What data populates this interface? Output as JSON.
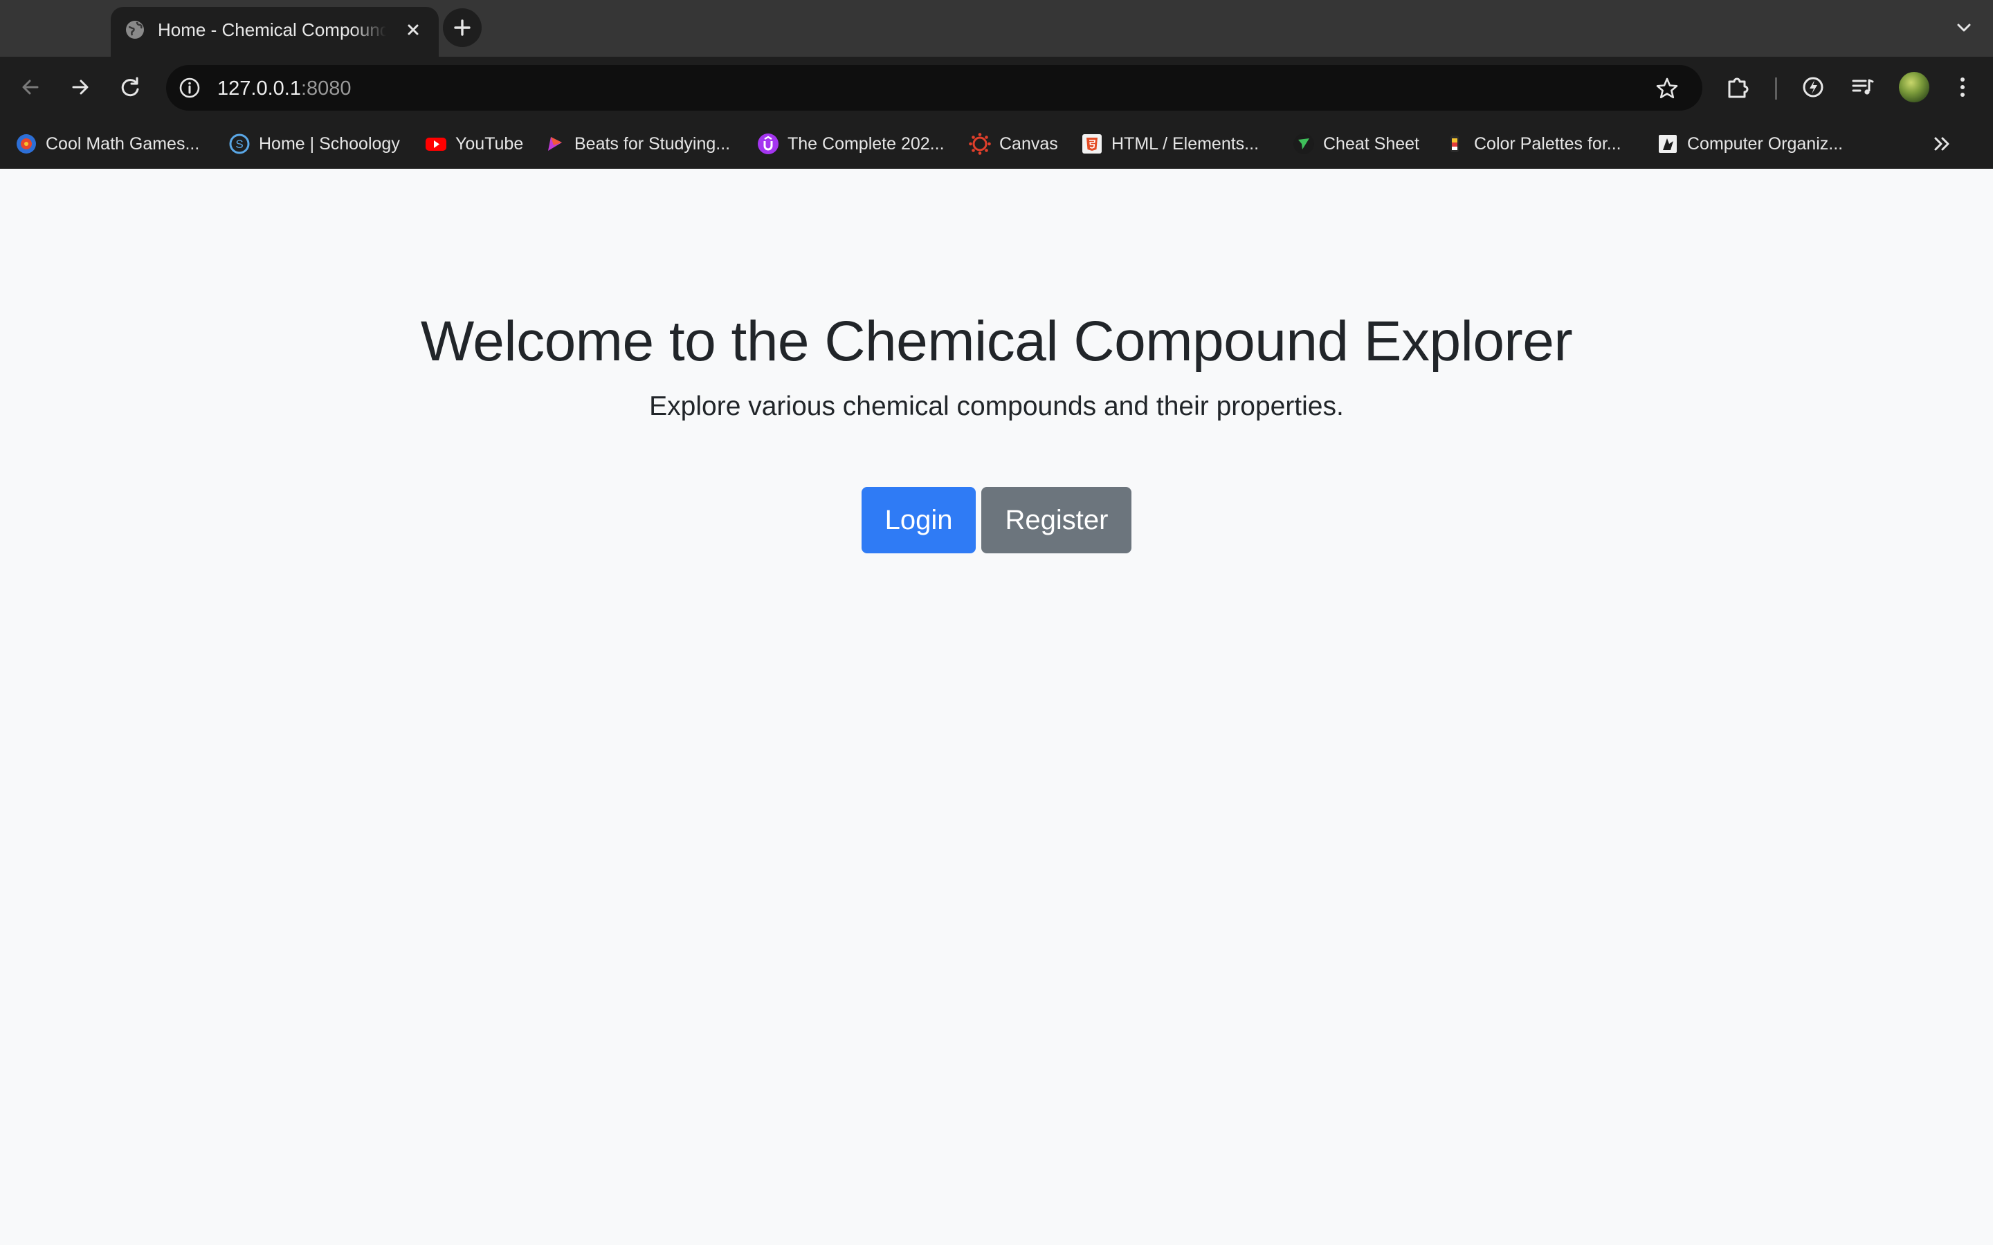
{
  "browser": {
    "tab": {
      "title": "Home - Chemical Compound Explorer",
      "favicon": "globe-icon"
    },
    "toolbar": {
      "url_host": "127.0.0.1",
      "url_port": ":8080"
    },
    "bookmarks": [
      {
        "label": "Cool Math Games...",
        "icon": "coolmath-icon",
        "color": "#e8462c"
      },
      {
        "label": "Home | Schoology",
        "icon": "schoology-icon",
        "color": "#5aa7e6"
      },
      {
        "label": "YouTube",
        "icon": "youtube-icon",
        "color": "#ff0000"
      },
      {
        "label": "Beats for Studying...",
        "icon": "beats-icon",
        "color": "#c03ad6"
      },
      {
        "label": "The Complete 202...",
        "icon": "udemy-icon",
        "color": "#a435f0"
      },
      {
        "label": "Canvas",
        "icon": "canvas-icon",
        "color": "#e13f2b"
      },
      {
        "label": "HTML / Elements...",
        "icon": "html-icon",
        "color": "#e44d26"
      },
      {
        "label": "Cheat Sheet",
        "icon": "cheatsheet-icon",
        "color": "#3fbf5a"
      },
      {
        "label": "Color Palettes for...",
        "icon": "palette-icon",
        "color": "#f4c430"
      },
      {
        "label": "Computer Organiz...",
        "icon": "book-icon",
        "color": "#dddddd"
      }
    ]
  },
  "page": {
    "title": "Welcome to the Chemical Compound Explorer",
    "subtitle": "Explore various chemical compounds and their properties.",
    "login_label": "Login",
    "register_label": "Register"
  },
  "colors": {
    "primary": "#2f7bf5",
    "secondary": "#6c757d",
    "background": "#f8f9fa",
    "text": "#212529"
  }
}
